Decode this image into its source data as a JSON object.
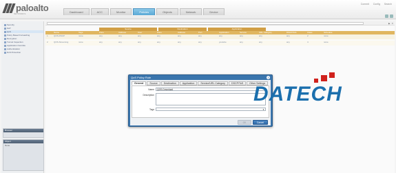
{
  "header": {
    "brand": "paloalto",
    "brand_sub": "NETWORKS",
    "tabs": [
      {
        "label": "Dashboard"
      },
      {
        "label": "ACC"
      },
      {
        "label": "Monitor"
      },
      {
        "label": "Policies"
      },
      {
        "label": "Objects"
      },
      {
        "label": "Network"
      },
      {
        "label": "Device"
      }
    ],
    "active_tab": "Policies",
    "right_links": [
      "Commit",
      "Config",
      "Search"
    ]
  },
  "sidebar": {
    "items": [
      {
        "label": "Security"
      },
      {
        "label": "NAT"
      },
      {
        "label": "QoS"
      },
      {
        "label": "Policy Based Forwarding"
      },
      {
        "label": "Decryption"
      },
      {
        "label": "Tunnel Inspection"
      },
      {
        "label": "Application Override"
      },
      {
        "label": "Authentication"
      },
      {
        "label": "DoS Protection"
      }
    ],
    "selected_index": 2,
    "panels": [
      {
        "title": "Browser",
        "body": ""
      },
      {
        "title": "Object",
        "body": "None"
      }
    ]
  },
  "policy_table": {
    "column_groups": [
      "Source",
      "Destination",
      "Application"
    ],
    "columns": [
      "Name",
      "Tags",
      "Zone",
      "Address",
      "User",
      "Zone",
      "Address",
      "Port",
      "Application",
      "Service",
      "URL Category",
      "DSCP/ToS",
      "Class",
      "Schedule"
    ],
    "rows": [
      {
        "num": "1",
        "name": "QOS-DSCP",
        "tags": "none",
        "zone": "any",
        "address": "any",
        "user": "any",
        "dzone": "any",
        "daddr": "any",
        "port": "any",
        "app": "any",
        "service": "any",
        "url": "any",
        "dscp": "any",
        "cls": "2",
        "sched": "none"
      },
      {
        "num": "2",
        "name": "QOS-Streaming",
        "tags": "none",
        "zone": "any",
        "address": "any",
        "user": "any",
        "dzone": "any",
        "daddr": "any",
        "port": "any",
        "app": "youtube",
        "service": "any",
        "url": "any",
        "dscp": "any",
        "cls": "4",
        "sched": "none"
      }
    ]
  },
  "dialog": {
    "title": "QoS Policy Rule",
    "help_icon": "?",
    "tabs": [
      "General",
      "Source",
      "Destination",
      "Application",
      "Service/URL Category",
      "DSCP/ToS",
      "Other Settings"
    ],
    "active_tab": "General",
    "name_label": "Name",
    "name_value": "QOS-Download",
    "description_label": "Description",
    "tags_label": "Tags",
    "ok_label": "OK",
    "cancel_label": "Cancel"
  },
  "watermark": {
    "text": "DATECH"
  },
  "colors": {
    "accent": "#3a75ad",
    "table_header": "#e0b660",
    "brand_red": "#d0211c"
  }
}
